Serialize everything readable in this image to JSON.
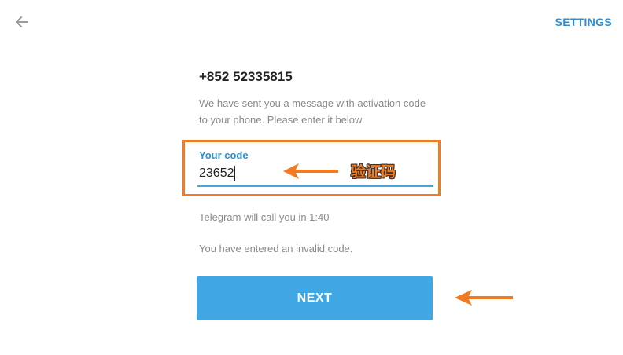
{
  "header": {
    "back_icon": "arrow-left-icon",
    "settings_label": "SETTINGS"
  },
  "main": {
    "phone_number": "+852 52335815",
    "info_text": "We have sent you a message with activation code to your phone. Please enter it below.",
    "code_field": {
      "label": "Your code",
      "value": "23652"
    },
    "call_text": "Telegram will call you in 1:40",
    "error_text": "You have entered an invalid code.",
    "next_label": "NEXT"
  },
  "annotations": {
    "code_label": "验证码",
    "accent_color": "#f07b22"
  },
  "colors": {
    "link": "#2f8fd0",
    "button": "#40a7e3",
    "muted_text": "#8a8a8a"
  }
}
